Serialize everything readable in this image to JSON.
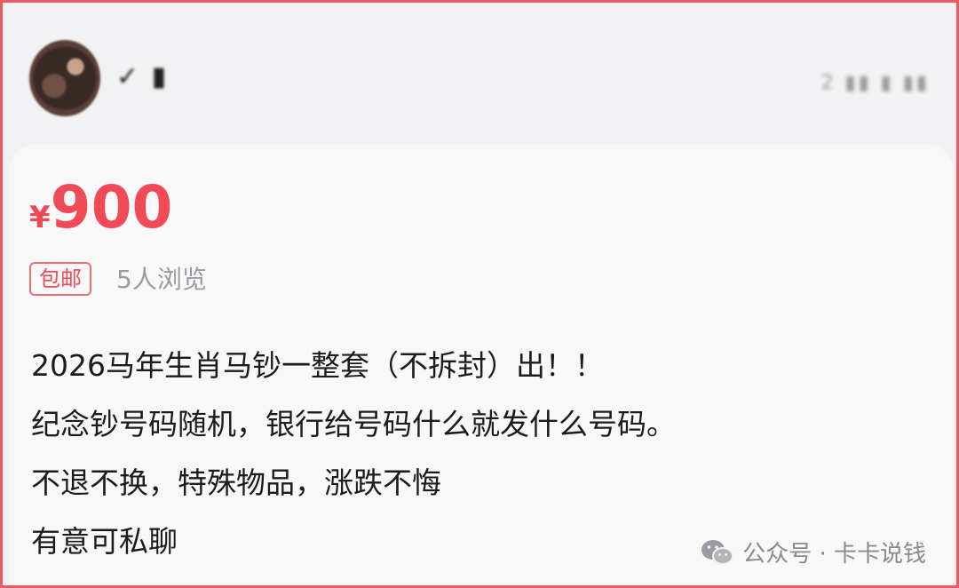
{
  "post": {
    "user": {
      "name": "✓ ▮",
      "time": "2 ▮▮ ▮ ▮▮"
    },
    "price": {
      "currency": "¥",
      "amount": "900"
    },
    "tag": "包邮",
    "views": "5人浏览",
    "description": [
      "2026马年生肖马钞一整套（不拆封）出！！",
      "纪念钞号码随机，银行给号码什么就发什么号码。",
      "不退不换，特殊物品，涨跌不悔",
      "有意可私聊"
    ]
  },
  "watermark": {
    "text": "公众号 · 卡卡说钱",
    "icon": "wechat-icon"
  },
  "colors": {
    "price": "#ef4a56",
    "frame": "#ec5a5f",
    "tag_border": "#ef6d74",
    "views": "#9a9aa0"
  }
}
